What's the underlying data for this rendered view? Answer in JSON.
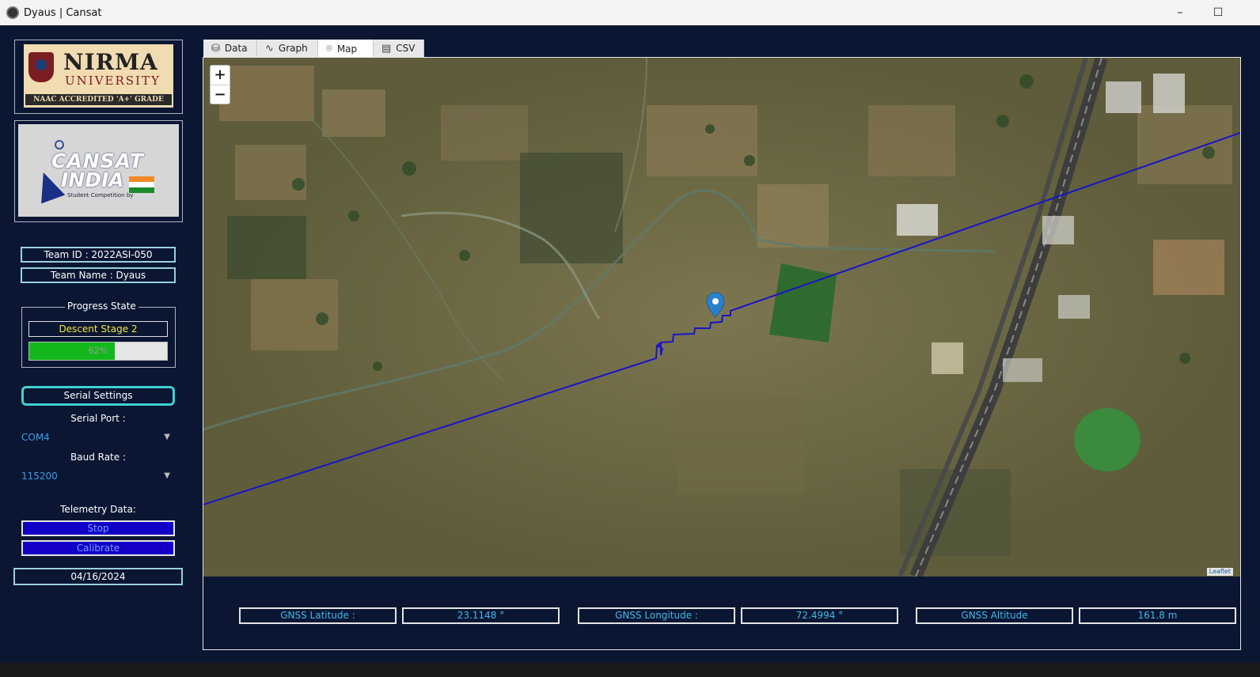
{
  "window": {
    "title": "Dyaus | Cansat",
    "minimize": "–",
    "maximize": "☐"
  },
  "logos": {
    "nirma_line1": "NIRMA",
    "nirma_line2": "UNIVERSITY",
    "nirma_line3": "NAAC ACCREDITED 'A+' GRADE",
    "cansat_line1": "CANSAT",
    "cansat_line2": "INDIA",
    "cansat_line3": "Student Competition by"
  },
  "team": {
    "id": "Team ID : 2022ASI-050",
    "name": "Team Name : Dyaus"
  },
  "progress": {
    "title": "Progress State",
    "stage": "Descent Stage 2",
    "percent": 62,
    "percent_label": "62%"
  },
  "serial": {
    "button": "Serial Settings",
    "port_label": "Serial Port :",
    "port_value": "COM4",
    "baud_label": "Baud Rate :",
    "baud_value": "115200"
  },
  "telemetry": {
    "label": "Telemetry Data:",
    "stop": "Stop",
    "calibrate": "Calibrate"
  },
  "date": "04/16/2024",
  "tabs": [
    {
      "label": "Data",
      "icon": "database-icon",
      "glyph": "⛁"
    },
    {
      "label": "Graph",
      "icon": "graph-icon",
      "glyph": "∿"
    },
    {
      "label": "Map",
      "icon": "map-pin-icon",
      "glyph": "⌾"
    },
    {
      "label": "CSV",
      "icon": "csv-icon",
      "glyph": "▤"
    }
  ],
  "map": {
    "zoom_in": "+",
    "zoom_out": "−",
    "attribution": "Leaflet",
    "path_color": "#1a14c8",
    "marker_color": "#2a81cb"
  },
  "gnss": {
    "lat_label": "GNSS Latitude :",
    "lat_value": "23.1148 °",
    "lon_label": "GNSS Longitude :",
    "lon_value": "72.4994 °",
    "alt_label": "GNSS Altitude",
    "alt_value": "161.8 m"
  },
  "colors": {
    "background": "#0b1633",
    "accent_cyan": "#3fd1d1",
    "progress_green": "#12b81c",
    "button_blue": "#1200c6"
  }
}
